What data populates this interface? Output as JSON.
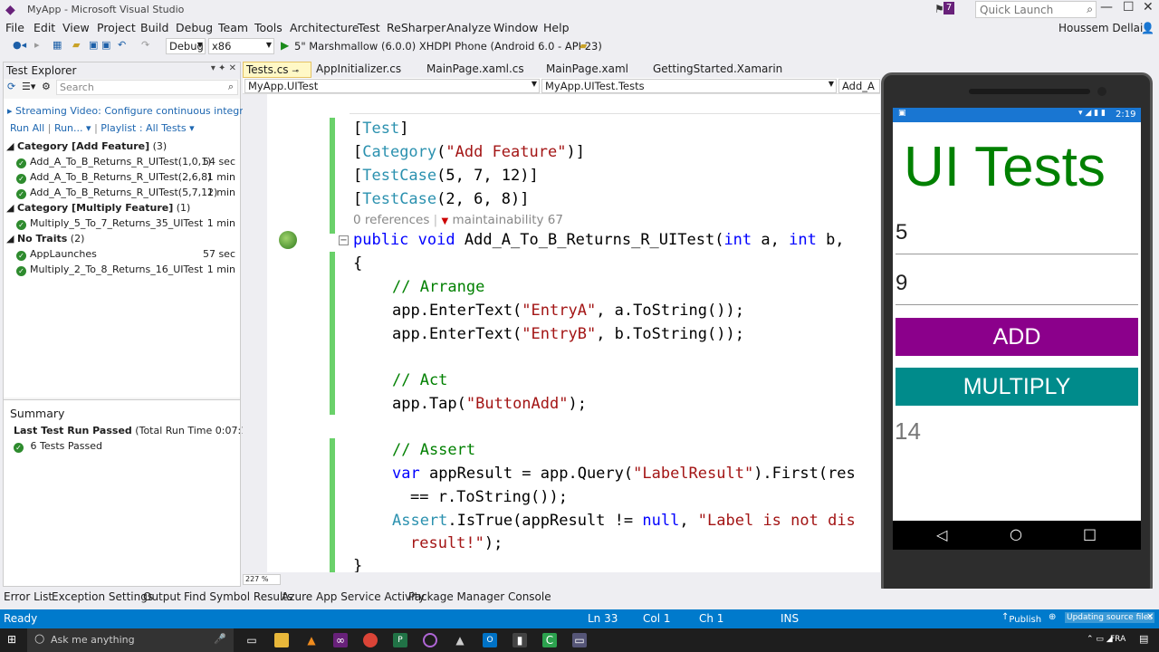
{
  "window": {
    "title": "MyApp - Microsoft Visual Studio",
    "user": "Houssem Dellai",
    "quick_launch_placeholder": "Quick Launch",
    "notification_count": "7"
  },
  "menu": [
    "File",
    "Edit",
    "View",
    "Project",
    "Build",
    "Debug",
    "Team",
    "Tools",
    "Architecture",
    "Test",
    "ReSharper",
    "Analyze",
    "Window",
    "Help"
  ],
  "toolbar": {
    "config": "Debug",
    "platform": "x86",
    "run_target": "5\" Marshmallow (6.0.0) XHDPI Phone (Android 6.0 - API 23)"
  },
  "test_explorer": {
    "title": "Test Explorer",
    "search_placeholder": "Search",
    "streaming": "Streaming Video: Configure continuous integr",
    "run_all": "Run All",
    "run": "Run...",
    "playlist": "Playlist : All Tests",
    "groups": [
      {
        "label": "Category [Add Feature]",
        "count": "(3)",
        "tests": [
          {
            "name": "Add_A_To_B_Returns_R_UITest(1,0,1)",
            "time": "54 sec"
          },
          {
            "name": "Add_A_To_B_Returns_R_UITest(2,6,8)",
            "time": "1 min"
          },
          {
            "name": "Add_A_To_B_Returns_R_UITest(5,7,12)",
            "time": "1 min"
          }
        ]
      },
      {
        "label": "Category [Multiply Feature]",
        "count": "(1)",
        "tests": [
          {
            "name": "Multiply_5_To_7_Returns_35_UITest",
            "time": "1 min"
          }
        ]
      },
      {
        "label": "No Traits",
        "count": "(2)",
        "tests": [
          {
            "name": "AppLaunches",
            "time": "57 sec"
          },
          {
            "name": "Multiply_2_To_8_Returns_16_UITest",
            "time": "1 min"
          }
        ]
      }
    ],
    "summary_title": "Summary",
    "last_run": "Last Test Run Passed",
    "run_time": "(Total Run Time 0:07:14)",
    "passed": "6 Tests Passed"
  },
  "tabs": [
    "Tests.cs",
    "AppInitializer.cs",
    "MainPage.xaml.cs",
    "MainPage.xaml",
    "GettingStarted.Xamarin"
  ],
  "nav": {
    "left": "MyApp.UITest",
    "middle": "MyApp.UITest.Tests",
    "right": "Add_A"
  },
  "code": {
    "l1_open": "[",
    "l1_attr": "Test",
    "l1_close": "]",
    "l2_open": "[",
    "l2_attr": "Category",
    "l2_rest_a": "(",
    "l2_str": "\"Add Feature\"",
    "l2_rest_b": ")]",
    "l3_open": "[",
    "l3_attr": "TestCase",
    "l3_rest": "(5, 7, 12)]",
    "l4_open": "[",
    "l4_attr": "TestCase",
    "l4_rest": "(2, 6, 8)]",
    "lens_refs": "0 references",
    "lens_maint": "maintainability 67",
    "sig_kw1": "public",
    "sig_kw2": "void",
    "sig_name": " Add_A_To_B_Returns_R_UITest(",
    "sig_kw3": "int",
    "sig_a": " a, ",
    "sig_kw4": "int",
    "sig_b": " b,",
    "brace_open": "{",
    "c_arrange": "// Arrange",
    "e1_a": "app.EnterText(",
    "e1_s": "\"EntryA\"",
    "e1_b": ", a.ToString());",
    "e2_a": "app.EnterText(",
    "e2_s": "\"EntryB\"",
    "e2_b": ", b.ToString());",
    "c_act": "// Act",
    "tap_a": "app.Tap(",
    "tap_s": "\"ButtonAdd\"",
    "tap_b": ");",
    "c_assert": "// Assert",
    "v_kw": "var",
    "v_a": " appResult = app.Query(",
    "v_s": "\"LabelResult\"",
    "v_b": ").First(res",
    "v_cont": "== r.ToString());",
    "as_ty": "Assert",
    "as_a": ".IsTrue(appResult != ",
    "as_kw": "null",
    "as_b": ", ",
    "as_s": "\"Label is not dis",
    "as_cont_s": "result!\"",
    "as_cont_b": ");",
    "brace_close": "}"
  },
  "zoom": "227 %",
  "phone": {
    "time": "2:19",
    "title": "UI Tests",
    "entry_a": "5",
    "entry_b": "9",
    "add": "ADD",
    "multiply": "MULTIPLY",
    "result": "14",
    "add_color": "#8b008b",
    "multiply_color": "#008b8b"
  },
  "bottom_tabs": [
    "Error List",
    "Exception Settings",
    "Output",
    "Find Symbol Results",
    "Azure App Service Activity",
    "Package Manager Console"
  ],
  "status": {
    "ready": "Ready",
    "ln": "Ln 33",
    "col": "Col 1",
    "ch": "Ch 1",
    "ins": "INS",
    "publish": "Publish",
    "updating": "Updating source files"
  },
  "taskbar": {
    "ask": "Ask me anything",
    "lang": "FRA"
  }
}
